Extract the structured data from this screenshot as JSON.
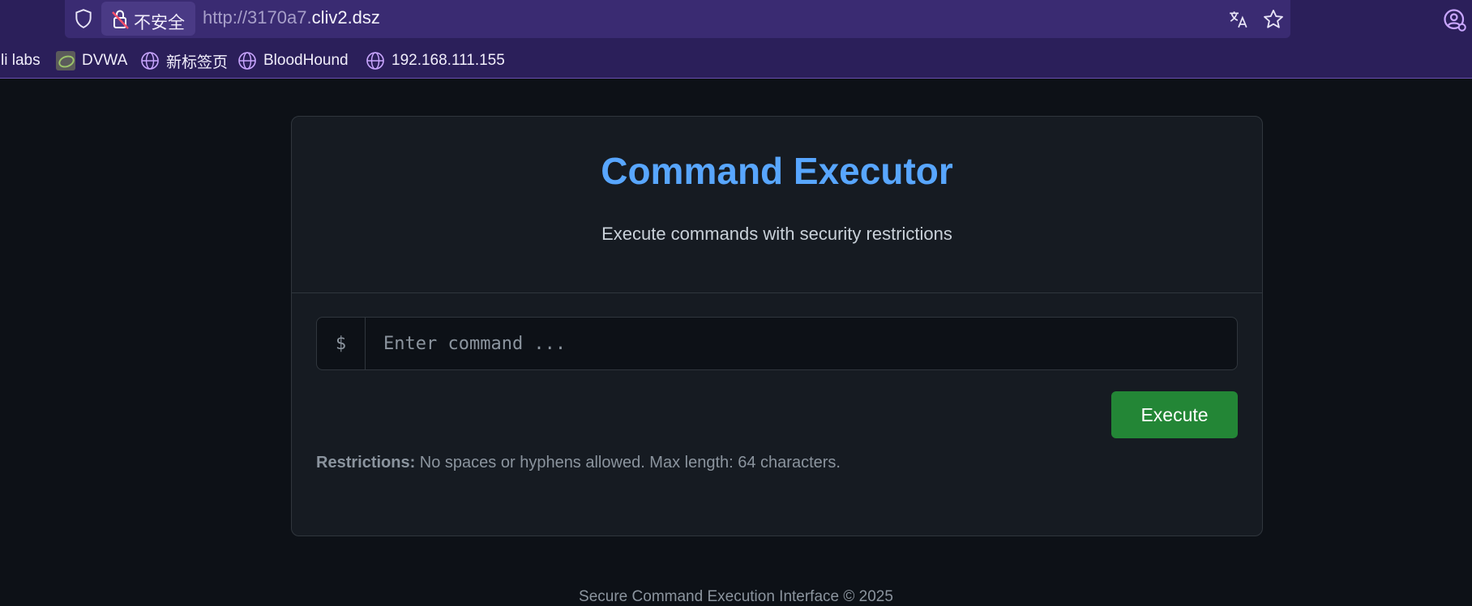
{
  "browser": {
    "security_label": "不安全",
    "url_scheme_host_dim": "http://3170a7.",
    "url_host": "cliv2.dsz",
    "bookmarks": [
      {
        "label": "li labs"
      },
      {
        "label": "DVWA"
      },
      {
        "label": "新标签页"
      },
      {
        "label": "BloodHound"
      },
      {
        "label": "192.168.111.155"
      }
    ]
  },
  "page": {
    "title": "Command Executor",
    "subtitle": "Execute commands with security restrictions",
    "prompt_symbol": "$",
    "input_placeholder": "Enter command ...",
    "execute_label": "Execute",
    "restrictions_label": "Restrictions:",
    "restrictions_text": " No spaces or hyphens allowed. Max length: 64 characters.",
    "footer_text": "Secure Command Execution Interface © 2025"
  },
  "colors": {
    "title": "#58a6ff",
    "execute_button": "#238636",
    "background": "#0d1117",
    "card": "#161b22",
    "browser_chrome": "#2b1f5a"
  }
}
